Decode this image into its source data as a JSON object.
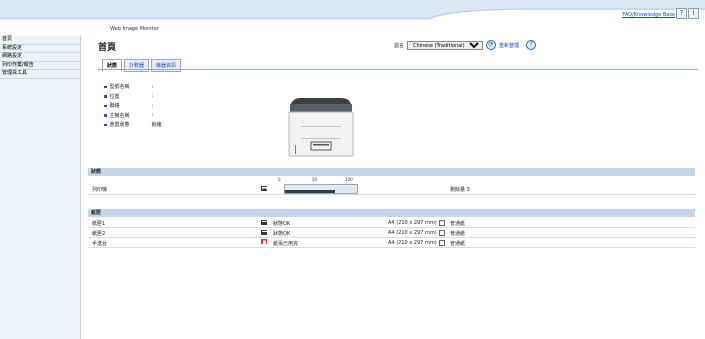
{
  "header": {
    "app_title": "Web Image Monitor",
    "faq_link": "FAQ/Knowledge Base",
    "help_btn": "?",
    "info_btn": "i"
  },
  "sidebar": {
    "items": [
      {
        "label": "首頁"
      },
      {
        "label": "系統設定"
      },
      {
        "label": "網路設定"
      },
      {
        "label": "列印作業/報告"
      },
      {
        "label": "管理員工具"
      }
    ]
  },
  "main": {
    "title": "首頁",
    "language_label": "語言",
    "language_value": "Chinese (Traditional)",
    "refresh_label": "重新整理",
    "tabs": [
      {
        "label": "狀態"
      },
      {
        "label": "計數器"
      },
      {
        "label": "機器資訊"
      }
    ],
    "info": [
      {
        "key": "型號名稱",
        "value": ":"
      },
      {
        "key": "位置",
        "value": ":"
      },
      {
        "key": "聯絡",
        "value": ":"
      },
      {
        "key": "主機名稱",
        "value": ":"
      },
      {
        "key": "裝置狀態",
        "value": "就緒"
      }
    ]
  },
  "toner": {
    "section_title": "狀態",
    "row_label": "列印機",
    "scale": [
      "0",
      "50",
      "100"
    ],
    "level_percent": 70,
    "remaining_label": "剩餘量 3"
  },
  "trays": {
    "section_title": "紙匣",
    "rows": [
      {
        "name": "紙匣1",
        "status": "狀態OK",
        "size": "A4 (210 x 297 mm)",
        "type": "普通紙",
        "error": false
      },
      {
        "name": "紙匣2",
        "status": "狀態OK",
        "size": "A4 (210 x 297 mm)",
        "type": "普通紙",
        "error": false
      },
      {
        "name": "手送台",
        "status": "紙張已用完",
        "size": "A4 (210 x 297 mm)",
        "type": "普通紙",
        "error": true
      }
    ]
  },
  "colors": {
    "accent": "#1a4fa3",
    "section_bg": "#c6d6ea",
    "sidebar_bg": "#eef1f6",
    "error": "#d33"
  }
}
